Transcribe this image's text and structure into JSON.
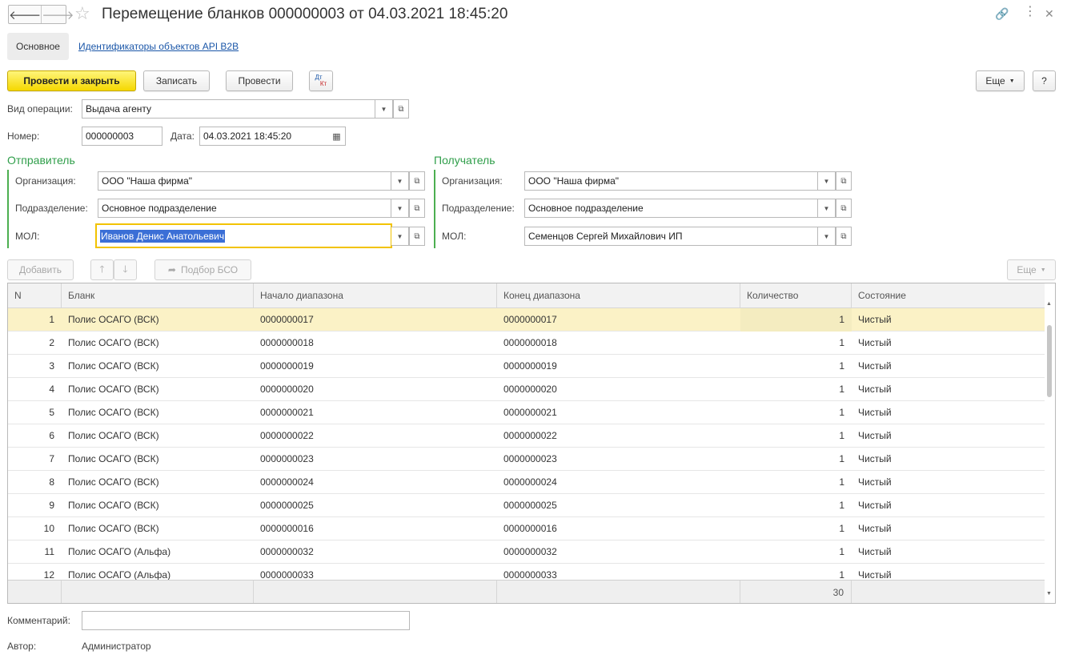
{
  "header": {
    "title": "Перемещение бланков 000000003 от 04.03.2021 18:45:20",
    "back_glyph": "🡐",
    "forward_glyph": "🡒"
  },
  "tabs": {
    "main": "Основное",
    "link": "Идентификаторы объектов API B2B"
  },
  "toolbar": {
    "post_close": "Провести и закрыть",
    "write": "Записать",
    "post": "Провести",
    "dtkt_top": "Дт",
    "dtkt_bottom": "Кт",
    "more": "Еще",
    "help": "?"
  },
  "form": {
    "operation_label": "Вид операции:",
    "operation_value": "Выдача агенту",
    "number_label": "Номер:",
    "number_value": "000000003",
    "date_label": "Дата:",
    "date_value": "04.03.2021 18:45:20"
  },
  "sender": {
    "title": "Отправитель",
    "org_label": "Организация:",
    "org_value": "ООО \"Наша фирма\"",
    "dept_label": "Подразделение:",
    "dept_value": "Основное подразделение",
    "mol_label": "МОЛ:",
    "mol_value": "Иванов Денис Анатольевич"
  },
  "receiver": {
    "title": "Получатель",
    "org_label": "Организация:",
    "org_value": "ООО \"Наша фирма\"",
    "dept_label": "Подразделение:",
    "dept_value": "Основное подразделение",
    "mol_label": "МОЛ:",
    "mol_value": "Семенцов Сергей Михайлович ИП"
  },
  "table_toolbar": {
    "add": "Добавить",
    "pick": "Подбор БСО",
    "more": "Еще"
  },
  "table": {
    "columns": [
      "N",
      "Бланк",
      "Начало диапазона",
      "Конец диапазона",
      "Количество",
      "Состояние"
    ],
    "rows": [
      [
        "1",
        "Полис ОСАГО (ВСК)",
        "0000000017",
        "0000000017",
        "1",
        "Чистый"
      ],
      [
        "2",
        "Полис ОСАГО (ВСК)",
        "0000000018",
        "0000000018",
        "1",
        "Чистый"
      ],
      [
        "3",
        "Полис ОСАГО (ВСК)",
        "0000000019",
        "0000000019",
        "1",
        "Чистый"
      ],
      [
        "4",
        "Полис ОСАГО (ВСК)",
        "0000000020",
        "0000000020",
        "1",
        "Чистый"
      ],
      [
        "5",
        "Полис ОСАГО (ВСК)",
        "0000000021",
        "0000000021",
        "1",
        "Чистый"
      ],
      [
        "6",
        "Полис ОСАГО (ВСК)",
        "0000000022",
        "0000000022",
        "1",
        "Чистый"
      ],
      [
        "7",
        "Полис ОСАГО (ВСК)",
        "0000000023",
        "0000000023",
        "1",
        "Чистый"
      ],
      [
        "8",
        "Полис ОСАГО (ВСК)",
        "0000000024",
        "0000000024",
        "1",
        "Чистый"
      ],
      [
        "9",
        "Полис ОСАГО (ВСК)",
        "0000000025",
        "0000000025",
        "1",
        "Чистый"
      ],
      [
        "10",
        "Полис ОСАГО (ВСК)",
        "0000000016",
        "0000000016",
        "1",
        "Чистый"
      ],
      [
        "11",
        "Полис ОСАГО (Альфа)",
        "0000000032",
        "0000000032",
        "1",
        "Чистый"
      ],
      [
        "12",
        "Полис ОСАГО (Альфа)",
        "0000000033",
        "0000000033",
        "1",
        "Чистый"
      ]
    ],
    "total_quantity": "30"
  },
  "footer": {
    "comment_label": "Комментарий:",
    "comment_value": "",
    "author_label": "Автор:",
    "author_value": "Администратор"
  },
  "colors": {
    "primary_button": "#f5d800",
    "selected_row": "#fbf2c6",
    "group_title": "#2f9e4a",
    "link": "#1a56a8"
  }
}
